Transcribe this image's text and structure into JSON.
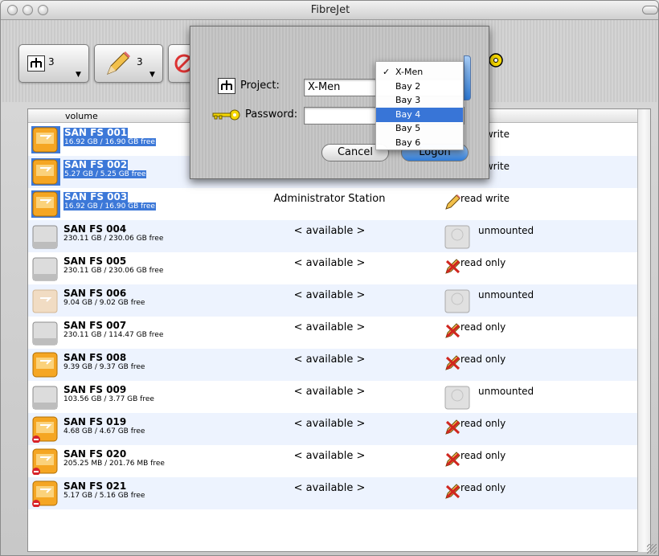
{
  "app": {
    "title": "FibreJet"
  },
  "toolbar": {
    "project_count": "3",
    "write_count": "3"
  },
  "table": {
    "columns": {
      "volume": "volume"
    },
    "rows": [
      {
        "name": "SAN FS 001",
        "size": "16.92 GB / 16.90 GB free",
        "status": "",
        "access": "read write",
        "icon": "orange-drive-icon",
        "selected": true,
        "access_icon": "pencil-icon"
      },
      {
        "name": "SAN FS 002",
        "size": "5.27 GB / 5.25 GB free",
        "status": "",
        "access": "read write",
        "icon": "orange-drive-icon",
        "selected": true,
        "access_icon": "pencil-icon"
      },
      {
        "name": "SAN FS 003",
        "size": "16.92 GB / 16.90 GB free",
        "status": "Administrator Station",
        "access": "read write",
        "icon": "orange-drive-icon",
        "selected": true,
        "access_icon": "pencil-icon"
      },
      {
        "name": "SAN FS 004",
        "size": "230.11 GB / 230.06 GB free",
        "status": "< available >",
        "access": "unmounted",
        "icon": "gray-drive-icon",
        "selected": false,
        "access_icon": "unmounted-disk-icon"
      },
      {
        "name": "SAN FS 005",
        "size": "230.11 GB / 230.06 GB free",
        "status": "< available >",
        "access": "read only",
        "icon": "gray-drive-icon",
        "selected": false,
        "access_icon": "crossed-pencil-icon"
      },
      {
        "name": "SAN FS 006",
        "size": "9.04 GB / 9.02 GB free",
        "status": "< available >",
        "access": "unmounted",
        "icon": "faded-drive-icon",
        "selected": false,
        "access_icon": "unmounted-disk-icon"
      },
      {
        "name": "SAN FS 007",
        "size": "230.11 GB / 114.47 GB free",
        "status": "< available >",
        "access": "read only",
        "icon": "gray-drive-icon",
        "selected": false,
        "access_icon": "crossed-pencil-icon"
      },
      {
        "name": "SAN FS 008",
        "size": "9.39 GB / 9.37 GB free",
        "status": "< available >",
        "access": "read only",
        "icon": "orange-drive-icon",
        "selected": false,
        "access_icon": "crossed-pencil-icon"
      },
      {
        "name": "SAN FS 009",
        "size": "103.56 GB / 3.77 GB free",
        "status": "< available >",
        "access": "unmounted",
        "icon": "gray-drive-icon",
        "selected": false,
        "access_icon": "unmounted-disk-icon"
      },
      {
        "name": "SAN FS 019",
        "size": "4.68 GB / 4.67 GB free",
        "status": "< available >",
        "access": "read only",
        "icon": "orange-drive-blocked-icon",
        "selected": false,
        "access_icon": "crossed-pencil-icon"
      },
      {
        "name": "SAN FS 020",
        "size": "205.25 MB / 201.76 MB free",
        "status": "< available >",
        "access": "read only",
        "icon": "orange-drive-blocked-icon",
        "selected": false,
        "access_icon": "crossed-pencil-icon"
      },
      {
        "name": "SAN FS 021",
        "size": "5.17 GB / 5.16 GB free",
        "status": "< available >",
        "access": "read only",
        "icon": "orange-drive-blocked-icon",
        "selected": false,
        "access_icon": "crossed-pencil-icon"
      }
    ]
  },
  "dialog": {
    "project_label": "Project:",
    "project_value": "X-Men",
    "password_label": "Password:",
    "password_value": "",
    "cancel_label": "Cancel",
    "logon_label": "Logon",
    "menu": {
      "checkmark": "✓",
      "items": [
        "X-Men",
        "Bay 2",
        "Bay 3",
        "Bay 4",
        "Bay 5",
        "Bay 6"
      ],
      "checked": "X-Men",
      "highlighted": "Bay 4"
    }
  },
  "colors": {
    "selection": "#3c78d8",
    "alt_row": "#edf3fe",
    "drive_orange": "#f5a623"
  }
}
